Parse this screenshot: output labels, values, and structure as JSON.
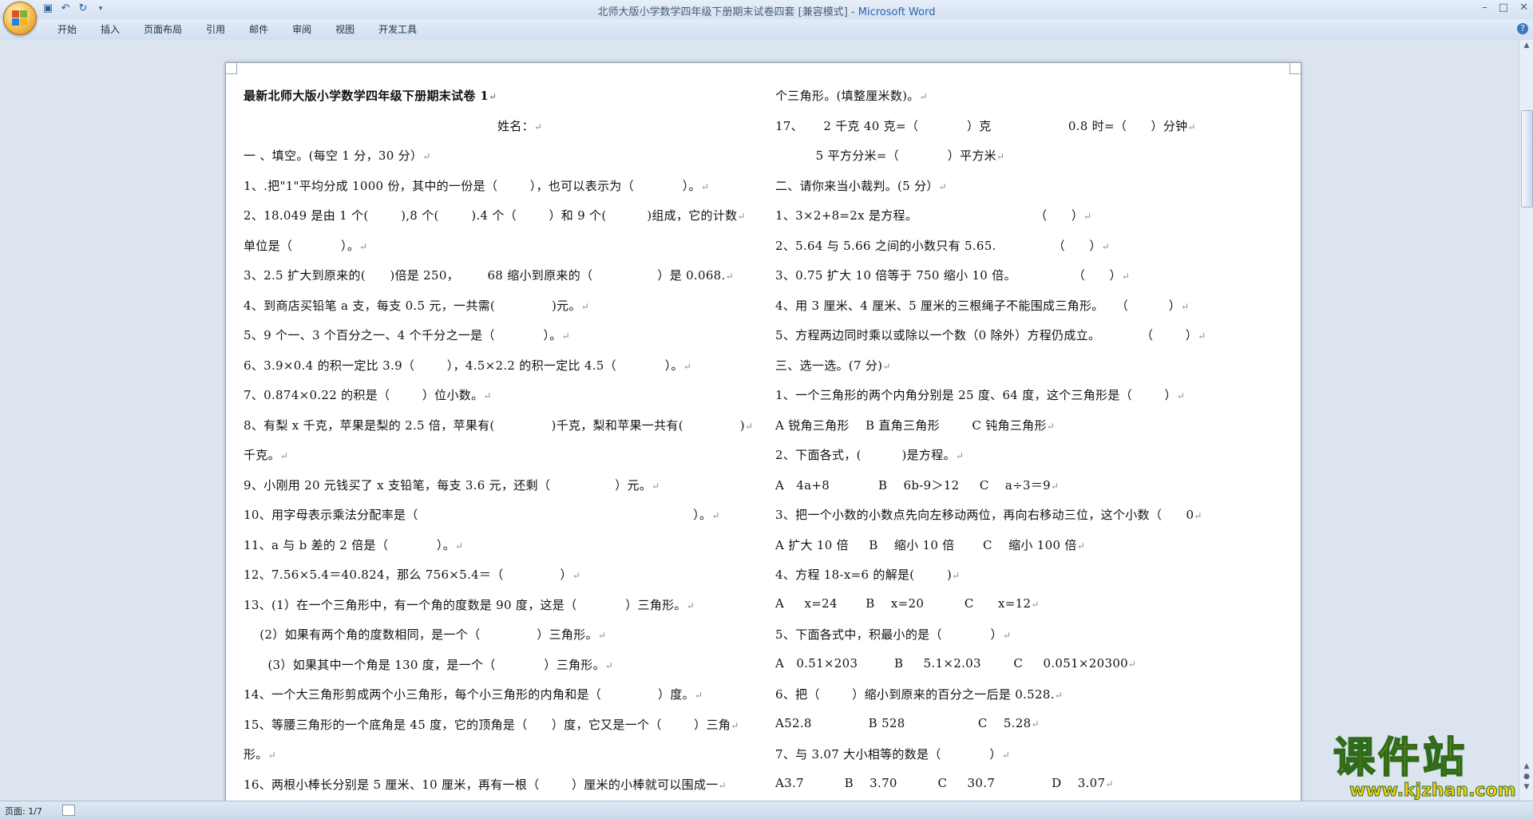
{
  "window": {
    "title_doc": "北师大版小学数学四年级下册期末试卷四套 [兼容模式]",
    "title_sep": " - ",
    "title_app": "Microsoft Word"
  },
  "ribbon": {
    "tabs": [
      "开始",
      "插入",
      "页面布局",
      "引用",
      "邮件",
      "审阅",
      "视图",
      "开发工具"
    ],
    "help": "?"
  },
  "left_column": [
    "最新北师大版小学数学四年级下册期末试卷 1",
    "姓名：",
    "一 、填空。(每空 1 分，30 分）",
    "1、.把\"1\"平均分成 1000 份，其中的一份是（        ），也可以表示为（            ）。",
    "2、18.049 是由 1 个(        ),8 个(        ).4 个（        ）和 9 个(          )组成，它的计数",
    "单位是（            ）。",
    "3、2.5 扩大到原来的(      )倍是 250，       68 缩小到原来的（                ）是 0.068.",
    "4、到商店买铅笔 a 支，每支 0.5 元，一共需(              )元。",
    "5、9 个一、3 个百分之一、4 个千分之一是（            ）。",
    "6、3.9×0.4 的积一定比 3.9（        ），4.5×2.2 的积一定比 4.5（            ）。",
    "7、0.874×0.22 的积是（        ）位小数。",
    "8、有梨 x 千克，苹果是梨的 2.5 倍，苹果有(              )千克，梨和苹果一共有(              )",
    "千克。",
    "9、小刚用 20 元钱买了 x 支铅笔，每支 3.6 元，还剩（                ）元。",
    "10、用字母表示乘法分配率是（                                                                    ）。",
    "11、a 与 b 差的 2 倍是（            ）。",
    "12、7.56×5.4＝40.824，那么 756×5.4＝（              ）",
    "13、(1）在一个三角形中，有一个角的度数是 90 度，这是（            ）三角形。",
    "    (2）如果有两个角的度数相同，是一个（              ）三角形。",
    "      (3）如果其中一个角是 130 度，是一个（            ）三角形。",
    "14、一个大三角形剪成两个小三角形，每个小三角形的内角和是（              ）度。",
    "15、等腰三角形的一个底角是 45 度，它的顶角是（      ）度，它又是一个（        ）三角",
    "形。",
    "16、两根小棒长分别是 5 厘米、10 厘米，再有一根（        ）厘米的小棒就可以围成一"
  ],
  "right_column": [
    "个三角形。(填整厘米数)。",
    "17、     2 千克 40 克=（            ）克                   0.8 时=（      ）分钟",
    "          5 平方分米=（            ）平方米",
    "二、请你来当小裁判。(5 分）",
    "1、3×2+8=2x 是方程。                             （      ）",
    "2、5.64 与 5.66 之间的小数只有 5.65.              （      ）",
    "3、0.75 扩大 10 倍等于 750 缩小 10 倍。              （      ）",
    "4、用 3 厘米、4 厘米、5 厘米的三根绳子不能围成三角形。   （          ）",
    "5、方程两边同时乘以或除以一个数（0 除外）方程仍成立。          （        ）",
    "三、选一选。(7 分)",
    "1、一个三角形的两个内角分别是 25 度、64 度，这个三角形是（        ）",
    "A 锐角三角形    B 直角三角形        C 钝角三角形",
    "2、下面各式，(          )是方程。",
    "A   4a+8            B    6b-9＞12     C    a÷3＝9",
    "3、把一个小数的小数点先向左移动两位，再向右移动三位，这个小数（      0",
    "A 扩大 10 倍     B    缩小 10 倍       C    缩小 100 倍",
    "4、方程 18-x=6 的解是(        )",
    "A     x=24       B    x=20          C      x=12",
    "5、下面各式中，积最小的是（            ）",
    "A   0.51×203         B     5.1×2.03        C     0.051×20300",
    "6、把（        ）缩小到原来的百分之一后是 0.528.",
    "A52.8              B 528                  C    5.28",
    "7、与 3.07 大小相等的数是（            ）",
    "A3.7          B    3.70          C     30.7              D    3.07"
  ],
  "status": {
    "page": "页面: 1/7"
  },
  "watermark": {
    "big": "课件站",
    "small": "www.kjzhan.com"
  }
}
